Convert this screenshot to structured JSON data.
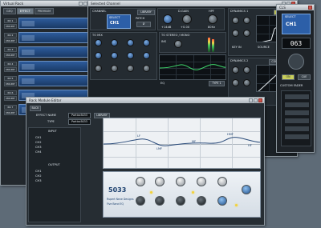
{
  "virtual_rack": {
    "title": "Virtual Rack",
    "tabs": [
      "GEQ",
      "EFFECT",
      "PREMIUM"
    ],
    "rows": [
      {
        "name": "RK 1",
        "action": "MOUNT"
      },
      {
        "name": "RK 2",
        "action": "MOUNT"
      },
      {
        "name": "RK 3",
        "action": "MOUNT"
      },
      {
        "name": "RK 4",
        "action": "MOUNT"
      },
      {
        "name": "RK 5",
        "action": "MOUNT"
      },
      {
        "name": "RK 6",
        "action": "MOUNT"
      },
      {
        "name": "RK 7",
        "action": "MOUNT"
      }
    ]
  },
  "selected_channel": {
    "title": "Selected Channel",
    "channel_label": "CHANNEL",
    "library_btn": "LIBRARY",
    "select_label": "SELECT",
    "ch_number": "CH1",
    "patch_label": "PATCH",
    "phase_label": "Ø",
    "mic_label": "TO MIX",
    "stereo_label": "TO STEREO / MONO",
    "ins_label": "INS",
    "d_gain": "D.GAIN",
    "hpf": "HPF",
    "gain_value": "+14dB",
    "dgain_value": "+0.00",
    "hpf_value": "80Hz",
    "dynamics1": "DYNAMICS 1",
    "dynamics2": "DYNAMICS 2",
    "gate_btn": "GATE",
    "comp_btn": "COMPRESSOR",
    "key_in": "KEY IN",
    "source": "SOURCE",
    "eq_label": "EQ",
    "eq_type": "TYPE 1"
  },
  "cls_window": {
    "title": "CLS",
    "select_label": "SELECT",
    "ch_id": "CH1",
    "number": "063",
    "on_label": "ON",
    "cue_label": "CUE",
    "custom_fader": "CUSTOM FADER"
  },
  "rack_editor": {
    "title": "Rack Module Editor",
    "back_btn": "BACK",
    "effect_name_label": "EFFECT NAME",
    "effect_name_value": "Portico5033",
    "library_btn": "LIBRARY",
    "type_label": "TYPE",
    "type_value": "Portico5033",
    "input_label": "INPUT",
    "output_label": "OUTPUT",
    "input_list": [
      "CH1",
      "CH2",
      "CH3",
      "CH4"
    ],
    "output_list": [
      "CH1",
      "CH2",
      "CH3"
    ],
    "eq_bands": [
      "LF",
      "LMF",
      "MF",
      "HMF",
      "HF"
    ],
    "plate_model": "5033",
    "plate_name": "Rupert Neve Designs",
    "plate_subtitle": "Five Band EQ"
  }
}
